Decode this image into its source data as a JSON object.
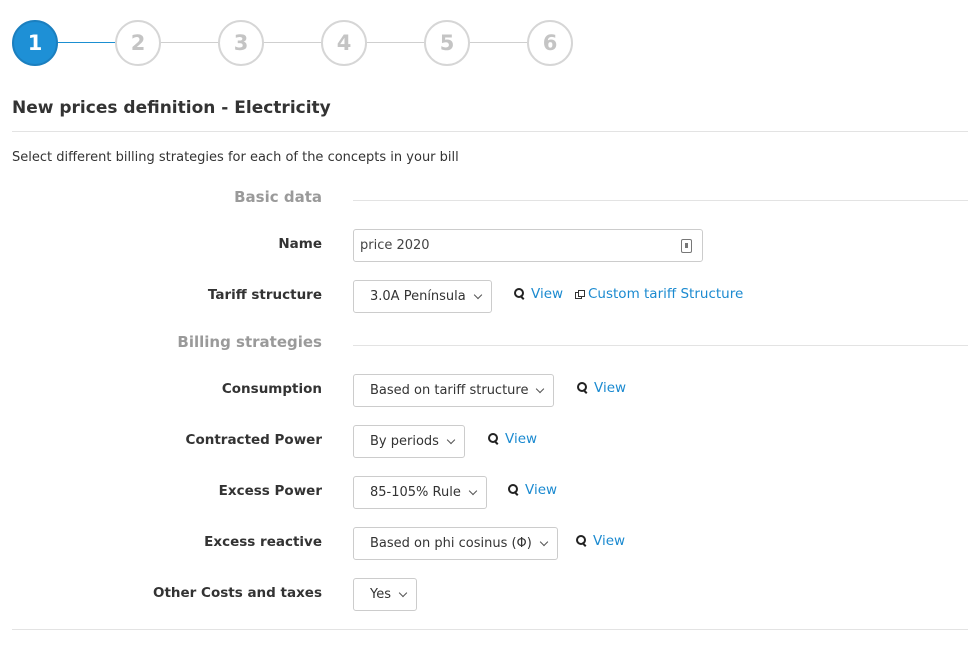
{
  "stepper": {
    "steps": [
      "1",
      "2",
      "3",
      "4",
      "5",
      "6"
    ],
    "active": "1"
  },
  "page": {
    "title": "New prices definition - Electricity",
    "subtitle": "Select different billing strategies for each of the concepts in your bill"
  },
  "basic_data": {
    "heading": "Basic data",
    "name_label": "Name",
    "name_value": "price 2020",
    "tariff_label": "Tariff structure",
    "tariff_value": "3.0A Península",
    "view_label": "View",
    "custom_link": "Custom tariff Structure"
  },
  "billing": {
    "heading": "Billing strategies",
    "rows": [
      {
        "label": "Consumption",
        "value": "Based on tariff structure",
        "view": "View"
      },
      {
        "label": "Contracted Power",
        "value": "By periods",
        "view": "View"
      },
      {
        "label": "Excess Power",
        "value": "85-105% Rule",
        "view": "View"
      },
      {
        "label": "Excess reactive",
        "value": "Based on phi cosinus (Φ)",
        "view": "View"
      },
      {
        "label": "Other Costs and taxes",
        "value": "Yes"
      }
    ]
  },
  "colors": {
    "accent": "#1e90d6",
    "link": "#1b8ad0",
    "muted": "#9a9a9a"
  }
}
